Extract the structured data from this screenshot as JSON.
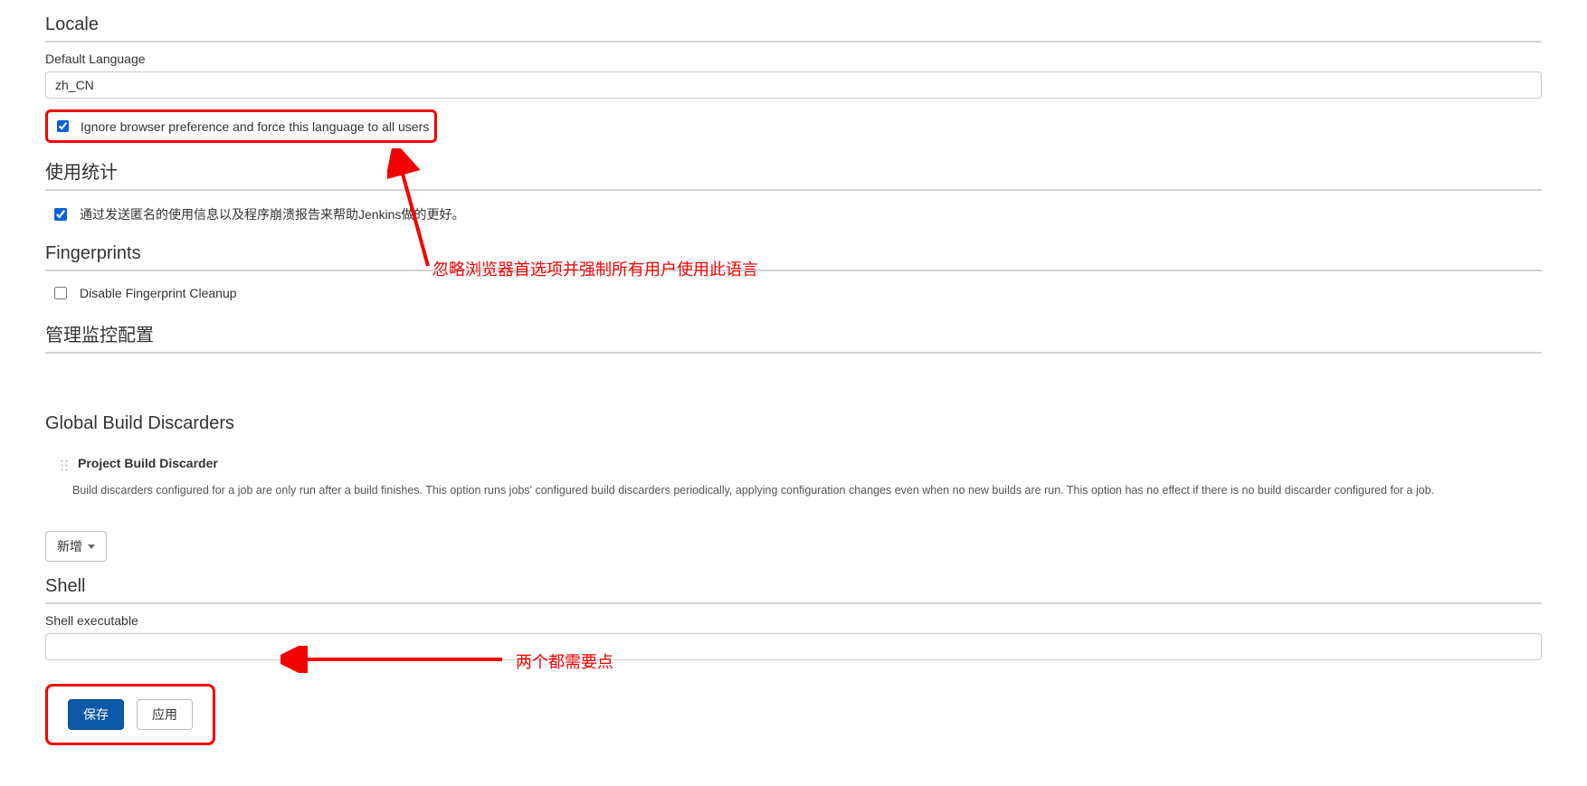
{
  "locale": {
    "title": "Locale",
    "default_language_label": "Default Language",
    "default_language_value": "zh_CN",
    "ignore_checkbox_label": "Ignore browser preference and force this language to all users",
    "ignore_checkbox_checked": true
  },
  "usage_stats": {
    "title": "使用统计",
    "checkbox_label": "通过发送匿名的使用信息以及程序崩溃报告来帮助Jenkins做的更好。",
    "checkbox_checked": true
  },
  "fingerprints": {
    "title": "Fingerprints",
    "checkbox_label": "Disable Fingerprint Cleanup",
    "checkbox_checked": false
  },
  "monitoring": {
    "title": "管理监控配置"
  },
  "discarders": {
    "title": "Global Build Discarders",
    "item_title": "Project Build Discarder",
    "item_desc": "Build discarders configured for a job are only run after a build finishes. This option runs jobs' configured build discarders periodically, applying configuration changes even when no new builds are run. This option has no effect if there is no build discarder configured for a job.",
    "add_button": "新增"
  },
  "shell": {
    "title": "Shell",
    "executable_label": "Shell executable",
    "executable_value": ""
  },
  "footer": {
    "save": "保存",
    "apply": "应用"
  },
  "annotations": {
    "ignore_explain": "忽略浏览器首选项并强制所有用户使用此语言",
    "both_click": "两个都需要点"
  }
}
